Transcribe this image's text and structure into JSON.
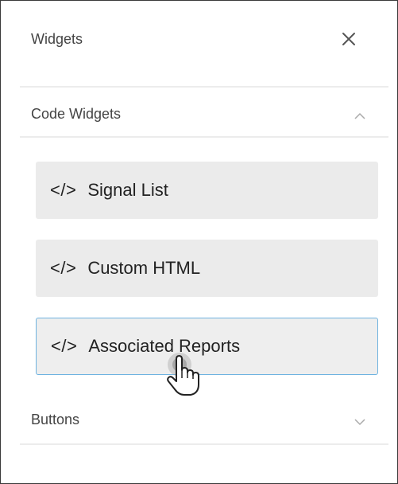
{
  "panel": {
    "title": "Widgets",
    "close_icon": "close-icon"
  },
  "sections": [
    {
      "label": "Code Widgets",
      "expanded": true,
      "items": [
        {
          "icon": "</>",
          "label": "Signal List"
        },
        {
          "icon": "</>",
          "label": "Custom HTML"
        },
        {
          "icon": "</>",
          "label": "Associated Reports"
        }
      ]
    },
    {
      "label": "Buttons",
      "expanded": false
    }
  ],
  "colors": {
    "active_border": "#6fb3e0",
    "item_bg": "#ebebeb",
    "divider": "#ececec"
  }
}
